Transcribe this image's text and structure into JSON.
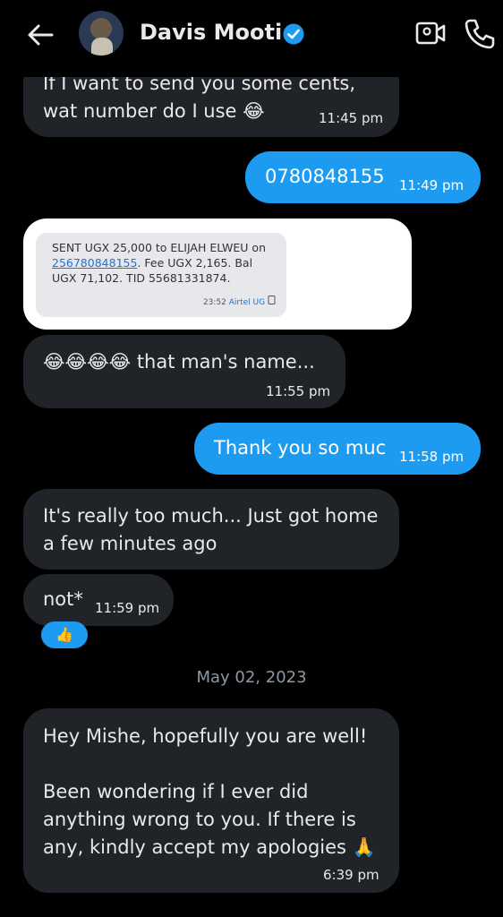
{
  "header": {
    "contact_name": "Davis Mooti",
    "icons": {
      "back": "back-arrow-icon",
      "verified": "verified-badge-icon",
      "video": "video-call-icon",
      "call": "phone-icon"
    },
    "accent": "#1d9bf0"
  },
  "messages": [
    {
      "dir": "in",
      "text": "If I want to send you some cents,\nwat number do I use 😂",
      "time": "11:45 pm"
    },
    {
      "dir": "out",
      "text": "0780848155",
      "time": "11:49 pm"
    },
    {
      "dir": "in",
      "text": "😂😂😂😂 that man's name...",
      "time": "11:55 pm"
    },
    {
      "dir": "out",
      "text": "Thank you so muc",
      "time": "11:58 pm"
    },
    {
      "dir": "in",
      "text": "It's really too much... Just got home\na few minutes ago",
      "time": ""
    },
    {
      "dir": "in",
      "text": "not*",
      "time": "11:59 pm"
    },
    {
      "dir": "in",
      "text": "Hey Mishe, hopefully you are well!\n\nBeen wondering if I ever did\nanything wrong to you. If there is\nany, kindly accept my apologies 🙏",
      "time": "6:39 pm"
    }
  ],
  "sms": {
    "text_before": "SENT UGX 25,000 to ELIJAH ELWEU on ",
    "link": "256780848155",
    "text_after": ". Fee UGX 2,165. Bal UGX 71,102. TID 55681331874.",
    "time": "23:52",
    "carrier": "Airtel UG"
  },
  "reaction": "👍",
  "date_separator": "May 02, 2023"
}
